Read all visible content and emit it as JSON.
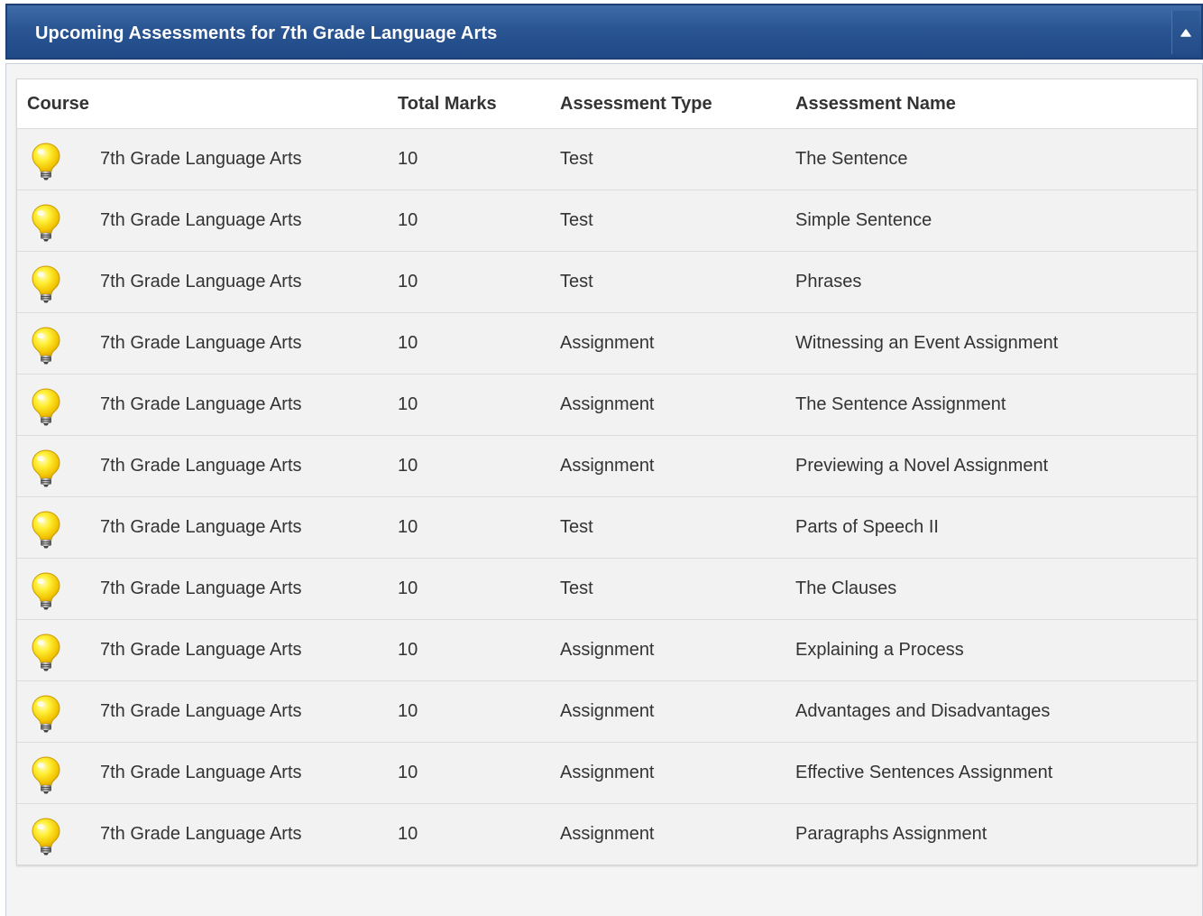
{
  "panel": {
    "title": "Upcoming Assessments for 7th Grade Language Arts",
    "collapse_icon": "caret-up-icon"
  },
  "table": {
    "columns": [
      "Course",
      "Total Marks",
      "Assessment Type",
      "Assessment Name"
    ],
    "row_icon": "lightbulb-icon",
    "rows": [
      {
        "course": "7th Grade Language Arts",
        "marks": "10",
        "type": "Test",
        "name": "The Sentence"
      },
      {
        "course": "7th Grade Language Arts",
        "marks": "10",
        "type": "Test",
        "name": "Simple Sentence"
      },
      {
        "course": "7th Grade Language Arts",
        "marks": "10",
        "type": "Test",
        "name": "Phrases"
      },
      {
        "course": "7th Grade Language Arts",
        "marks": "10",
        "type": "Assignment",
        "name": "Witnessing an Event Assignment"
      },
      {
        "course": "7th Grade Language Arts",
        "marks": "10",
        "type": "Assignment",
        "name": "The Sentence Assignment"
      },
      {
        "course": "7th Grade Language Arts",
        "marks": "10",
        "type": "Assignment",
        "name": "Previewing a Novel Assignment"
      },
      {
        "course": "7th Grade Language Arts",
        "marks": "10",
        "type": "Test",
        "name": "Parts of Speech II"
      },
      {
        "course": "7th Grade Language Arts",
        "marks": "10",
        "type": "Test",
        "name": "The Clauses"
      },
      {
        "course": "7th Grade Language Arts",
        "marks": "10",
        "type": "Assignment",
        "name": "Explaining a Process"
      },
      {
        "course": "7th Grade Language Arts",
        "marks": "10",
        "type": "Assignment",
        "name": "Advantages and Disadvantages"
      },
      {
        "course": "7th Grade Language Arts",
        "marks": "10",
        "type": "Assignment",
        "name": "Effective Sentences Assignment"
      },
      {
        "course": "7th Grade Language Arts",
        "marks": "10",
        "type": "Assignment",
        "name": "Paragraphs Assignment"
      }
    ]
  },
  "colors": {
    "header_bg": "#2a5593",
    "header_text": "#ffffff",
    "row_bg": "#f2f2f2",
    "text": "#333333"
  }
}
